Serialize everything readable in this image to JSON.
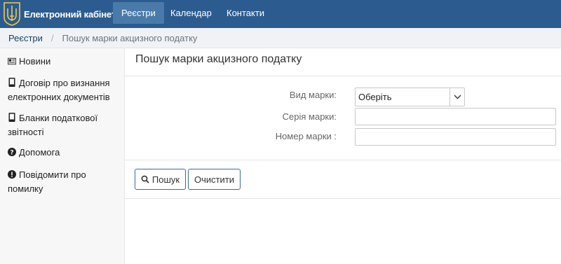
{
  "navbar": {
    "brand": "Електронний кабінет",
    "items": [
      {
        "label": "Реєстри",
        "active": true
      },
      {
        "label": "Календар",
        "active": false
      },
      {
        "label": "Контакти",
        "active": false
      }
    ]
  },
  "breadcrumb": {
    "root": "Реєстри",
    "current": "Пошук марки акцизного податку"
  },
  "sidebar": {
    "items": [
      {
        "icon": "newspaper-icon",
        "lines": [
          "Новини"
        ]
      },
      {
        "icon": "mobile-document-icon",
        "lines": [
          "Договір про визнання",
          "електронних документів"
        ]
      },
      {
        "icon": "mobile-document-icon",
        "lines": [
          "Бланки податкової",
          "звітності"
        ]
      },
      {
        "icon": "question-circle-icon",
        "lines": [
          "Допомога"
        ]
      },
      {
        "icon": "exclamation-circle-icon",
        "lines": [
          "Повідомити про",
          "помилку"
        ]
      }
    ]
  },
  "main": {
    "title": "Пошук марки акцизного податку",
    "form": {
      "type_label": "Вид марки:",
      "type_value": "Оберіть",
      "series_label": "Серія марки:",
      "series_value": "",
      "number_label": "Номер марки :",
      "number_value": ""
    },
    "buttons": {
      "search": "Пошук",
      "clear": "Очистити"
    }
  },
  "colors": {
    "navbar": "#2c5c8f",
    "navbar_active": "#4a7aaa",
    "button_border": "#3a6a9a"
  }
}
